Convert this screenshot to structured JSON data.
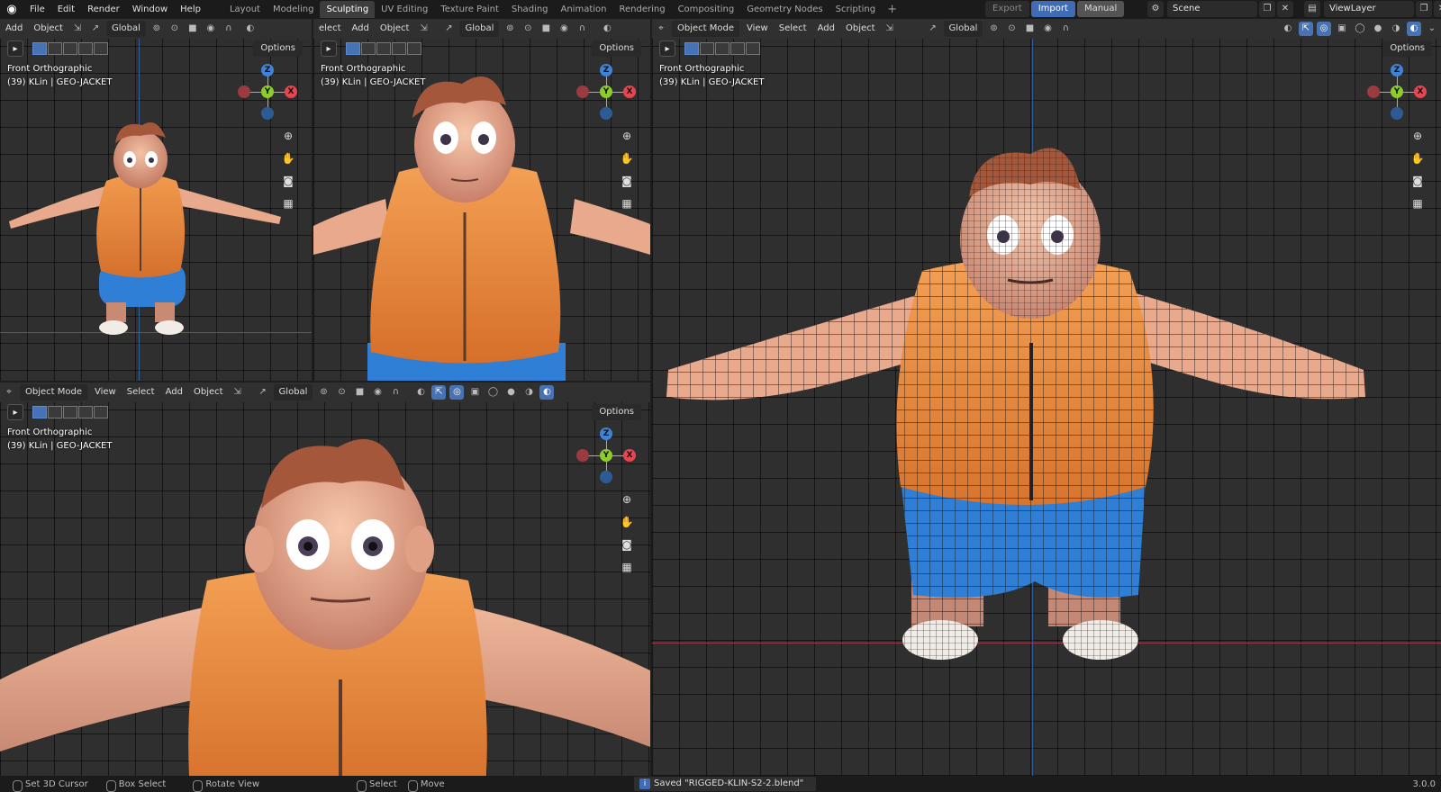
{
  "app": {
    "menu": [
      "File",
      "Edit",
      "Render",
      "Window",
      "Help"
    ],
    "workspace_tabs": [
      "Layout",
      "Modeling",
      "Sculpting",
      "UV Editing",
      "Texture Paint",
      "Shading",
      "Animation",
      "Rendering",
      "Compositing",
      "Geometry Nodes",
      "Scripting"
    ],
    "active_tab": "Sculpting",
    "export_label": "Export",
    "import_label": "Import",
    "manual_label": "Manual",
    "scene": "Scene",
    "view_layer": "ViewLayer"
  },
  "viewports": {
    "tl": {
      "menu": [
        "Add",
        "Object"
      ],
      "orientation": "Global",
      "options": "Options",
      "view": "Front Orthographic",
      "object": "(39) KLin | GEO-JACKET"
    },
    "tm": {
      "menu": [
        "elect",
        "Add",
        "Object"
      ],
      "orientation": "Global",
      "options": "Options",
      "view": "Front Orthographic",
      "object": "(39) KLin | GEO-JACKET"
    },
    "bl": {
      "mode": "Object Mode",
      "menu": [
        "View",
        "Select",
        "Add",
        "Object"
      ],
      "orientation": "Global",
      "options": "Options",
      "view": "Front Orthographic",
      "object": "(39) KLin | GEO-JACKET"
    },
    "r": {
      "mode": "Object Mode",
      "menu": [
        "View",
        "Select",
        "Add",
        "Object"
      ],
      "orientation": "Global",
      "options": "Options",
      "view": "Front Orthographic",
      "object": "(39) KLin | GEO-JACKET"
    }
  },
  "gizmo": {
    "z": "Z",
    "y": "Y",
    "x": "X",
    "colors": {
      "x": "#e5464f",
      "y": "#8ccc2c",
      "z": "#3f83d6"
    }
  },
  "statusbar": {
    "hints": [
      "Set 3D Cursor",
      "Box Select",
      "Rotate View",
      "Select",
      "Move"
    ],
    "message": "Saved \"RIGGED-KLIN-S2-2.blend\"",
    "version": "3.0.0"
  },
  "colors": {
    "accent": "#4772b3",
    "jacket": "#e9853d",
    "shorts": "#2f7fd6",
    "skin": "#e8a98d",
    "hair": "#a4573a"
  }
}
